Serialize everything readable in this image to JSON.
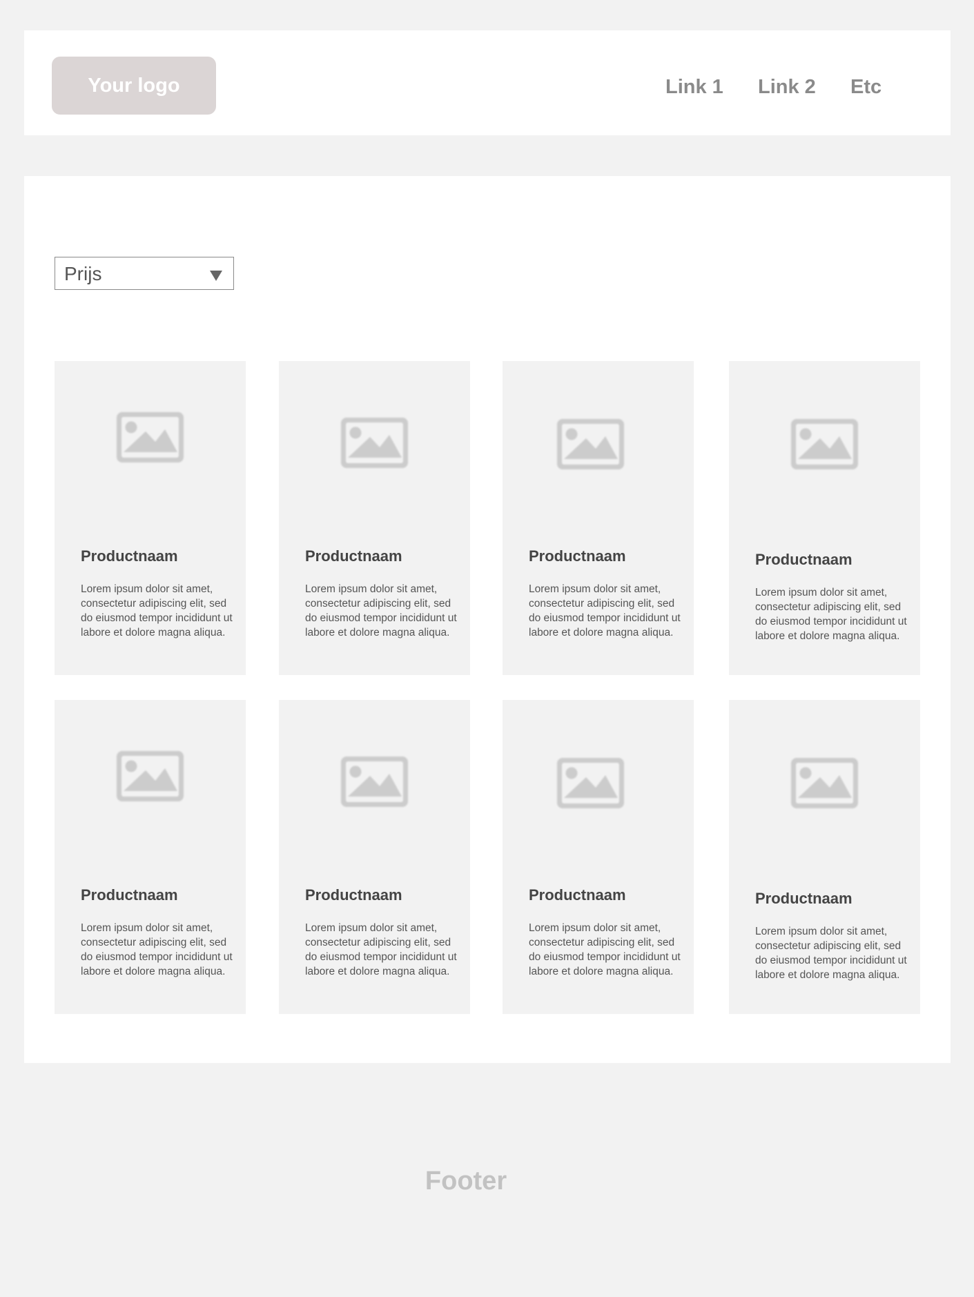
{
  "header": {
    "logo_text": "Your logo",
    "nav": [
      "Link 1",
      "Link 2",
      "Etc"
    ]
  },
  "filter": {
    "sort_value": "Prijs"
  },
  "products": [
    {
      "name": "Productnaam",
      "description": "Lorem ipsum dolor sit amet, consectetur adipiscing elit, sed do eiusmod tempor incididunt ut labore et dolore magna aliqua.",
      "image_icon": "image-placeholder-icon"
    },
    {
      "name": "Productnaam",
      "description": "Lorem ipsum dolor sit amet, consectetur adipiscing elit, sed do eiusmod tempor incididunt ut labore et dolore magna aliqua.",
      "image_icon": "image-placeholder-icon"
    },
    {
      "name": "Productnaam",
      "description": "Lorem ipsum dolor sit amet, consectetur adipiscing elit, sed do eiusmod tempor incididunt ut labore et dolore magna aliqua.",
      "image_icon": "image-placeholder-icon"
    },
    {
      "name": "Productnaam",
      "description": "Lorem ipsum dolor sit amet, consectetur adipiscing elit, sed do eiusmod tempor incididunt ut labore et dolore magna aliqua.",
      "image_icon": "image-placeholder-icon"
    },
    {
      "name": "Productnaam",
      "description": "Lorem ipsum dolor sit amet, consectetur adipiscing elit, sed do eiusmod tempor incididunt ut labore et dolore magna aliqua.",
      "image_icon": "image-placeholder-icon"
    },
    {
      "name": "Productnaam",
      "description": "Lorem ipsum dolor sit amet, consectetur adipiscing elit, sed do eiusmod tempor incididunt ut labore et dolore magna aliqua.",
      "image_icon": "image-placeholder-icon"
    },
    {
      "name": "Productnaam",
      "description": "Lorem ipsum dolor sit amet, consectetur adipiscing elit, sed do eiusmod tempor incididunt ut labore et dolore magna aliqua.",
      "image_icon": "image-placeholder-icon"
    },
    {
      "name": "Productnaam",
      "description": "Lorem ipsum dolor sit amet, consectetur adipiscing elit, sed do eiusmod tempor incididunt ut labore et dolore magna aliqua.",
      "image_icon": "image-placeholder-icon"
    }
  ],
  "footer": {
    "text": "Footer"
  },
  "colors": {
    "page_background": "#f2f2f2",
    "panel_background": "#ffffff",
    "card_background": "#f2f2f2",
    "logo_background": "#dbd5d5",
    "nav_text": "#8a8a8a",
    "title_text": "#444444",
    "body_text": "#555555",
    "placeholder_icon": "#cccccc",
    "footer_text": "#c2c2c2"
  }
}
